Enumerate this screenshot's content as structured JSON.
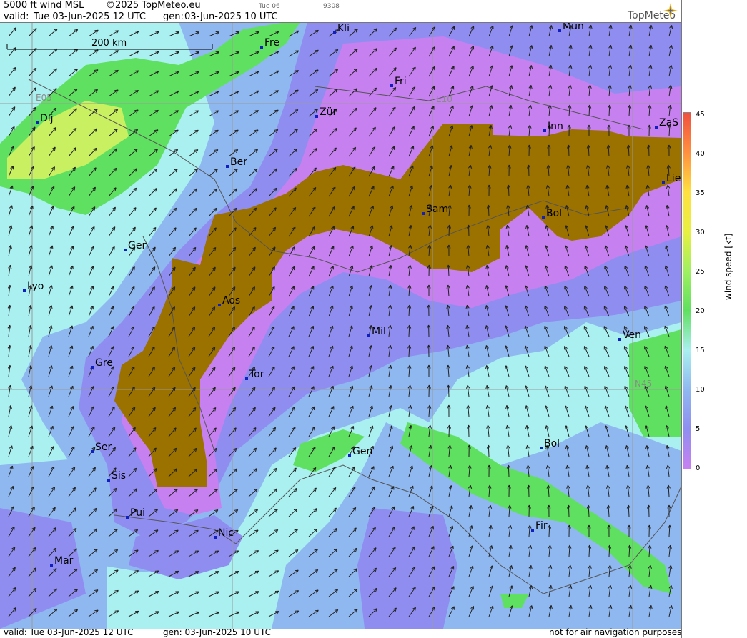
{
  "header": {
    "title": "5000 ft wind MSL",
    "copyright": "©2025 TopMeteo.eu",
    "day": "Tue 06",
    "code": "9308",
    "valid_label": "valid:",
    "valid_value": "Tue  03-Jun-2025  12 UTC",
    "gen_label": "gen:",
    "gen_value": "03-Jun-2025 10 UTC",
    "brand": "TopMeteo"
  },
  "map": {
    "scale_bar_label": "200 km",
    "grid_labels": [
      "E05",
      "E10",
      "N45"
    ],
    "cities": [
      "Kli",
      "Mun",
      "Fre",
      "Fri",
      "Dij",
      "Zür",
      "Inn",
      "ZaS",
      "Ber",
      "Lie",
      "Sam",
      "Bol",
      "Gen",
      "Lyo",
      "Aos",
      "Mil",
      "Ven",
      "Gre",
      "Tor",
      "Ser",
      "Gen",
      "Bol",
      "Sis",
      "Pui",
      "Nic",
      "Fir",
      "Mar"
    ],
    "colors": {
      "terrain": "#9b7200",
      "calm": "#c680f0",
      "light": "#8f8ef0",
      "moderate": "#8fb8f0",
      "fresh": "#aaf0f0",
      "strong": "#60e060",
      "stronger": "#c8f060"
    }
  },
  "legend": {
    "ticks": [
      "45",
      "40",
      "35",
      "30",
      "25",
      "20",
      "15",
      "10",
      "5",
      "0"
    ],
    "unit_label": "wind speed [kt]",
    "colors": [
      "#c680f0",
      "#8f8ef0",
      "#8fb8f0",
      "#aaf0f0",
      "#60e060",
      "#a0f060",
      "#e8f040",
      "#ffe040",
      "#ff9040",
      "#f05040"
    ]
  },
  "footer": {
    "valid": "valid:  Tue  03-Jun-2025  12 UTC",
    "gen": "gen: 03-Jun-2025 10 UTC",
    "disclaimer": "not for air navigation purposes"
  }
}
